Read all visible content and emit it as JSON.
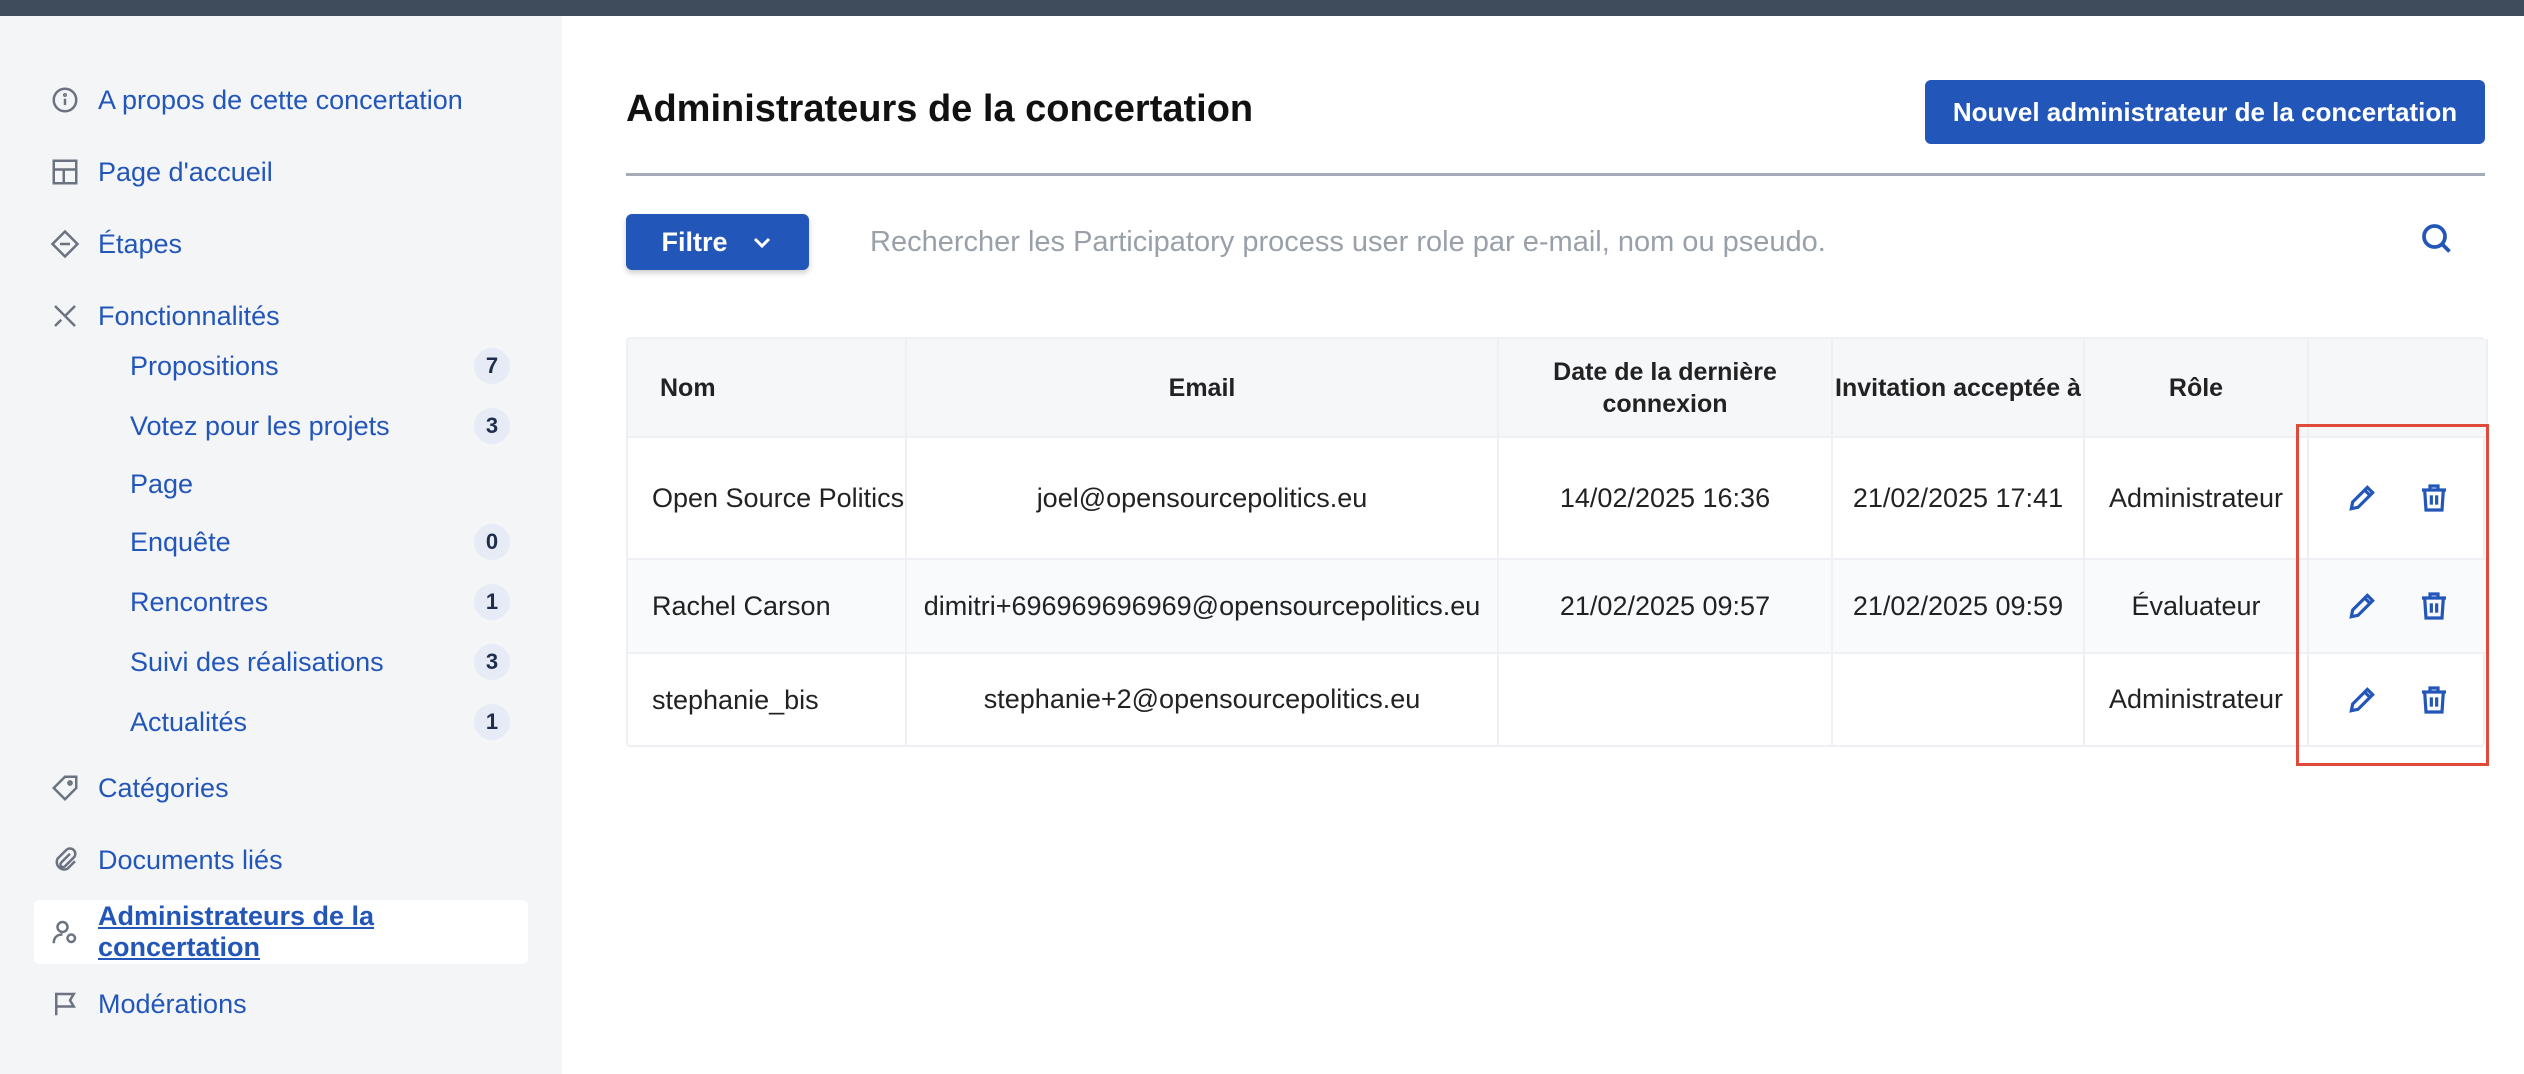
{
  "sidebar": {
    "items": [
      {
        "label": "A propos de cette concertation",
        "icon": "info-icon"
      },
      {
        "label": "Page d'accueil",
        "icon": "layout-icon"
      },
      {
        "label": "Étapes",
        "icon": "diamond-icon"
      },
      {
        "label": "Fonctionnalités",
        "icon": "tools-icon"
      }
    ],
    "components": [
      {
        "label": "Propositions",
        "count": "7"
      },
      {
        "label": "Votez pour les projets",
        "count": "3"
      },
      {
        "label": "Page",
        "count": ""
      },
      {
        "label": "Enquête",
        "count": "0"
      },
      {
        "label": "Rencontres",
        "count": "1"
      },
      {
        "label": "Suivi des réalisations",
        "count": "3"
      },
      {
        "label": "Actualités",
        "count": "1"
      }
    ],
    "bottom_items": [
      {
        "label": "Catégories",
        "icon": "tag-icon"
      },
      {
        "label": "Documents liés",
        "icon": "paperclip-icon"
      },
      {
        "label": "Administrateurs de la concertation",
        "icon": "user-settings-icon",
        "active": true
      },
      {
        "label": "Modérations",
        "icon": "flag-icon"
      }
    ]
  },
  "main": {
    "title": "Administrateurs de la concertation",
    "new_button": "Nouvel administrateur de la concertation",
    "filter_button": "Filtre",
    "search_placeholder": "Rechercher les Participatory process user role par e-mail, nom ou pseudo.",
    "table": {
      "headers": [
        "Nom",
        "Email",
        "Date de la dernière connexion",
        "Invitation acceptée à",
        "Rôle"
      ],
      "rows": [
        {
          "name": "Open Source Politics",
          "email": "joel@opensourcepolitics.eu",
          "last_login": "14/02/2025 16:36",
          "accepted": "21/02/2025 17:41",
          "role": "Administrateur"
        },
        {
          "name": "Rachel Carson",
          "email": "dimitri+696969696969@opensourcepolitics.eu",
          "last_login": "21/02/2025 09:57",
          "accepted": "21/02/2025 09:59",
          "role": "Évaluateur"
        },
        {
          "name": "stephanie_bis",
          "email": "stephanie+2@opensourcepolitics.eu",
          "last_login": "",
          "accepted": "",
          "role": "Administrateur"
        }
      ]
    }
  },
  "colors": {
    "accent": "#2356b9",
    "sidebar_bg": "#f4f5f7",
    "highlight": "#e04a3a",
    "topbar": "#3e4c5c"
  }
}
